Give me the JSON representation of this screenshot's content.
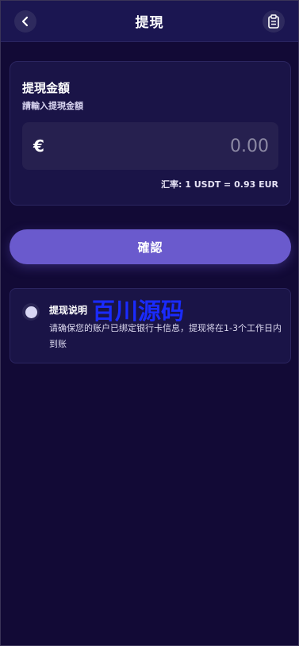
{
  "header": {
    "title": "提現",
    "back_icon": "chevron-left-icon",
    "record_icon": "clipboard-icon"
  },
  "amount": {
    "title": "提現金額",
    "subtitle": "請輸入提現金額",
    "currency_symbol": "€",
    "placeholder": "0.00",
    "value": "",
    "rate_text": "汇率: 1 USDT = 0.93 EUR"
  },
  "confirm_label": "確認",
  "info": {
    "title": "提现说明",
    "text": "请确保您的账户已绑定银行卡信息，提现将在1-3个工作日内到账"
  },
  "watermark": "百川源码",
  "colors": {
    "background": "#120a36",
    "header": "#1b1651",
    "card": "#1a1447",
    "accent": "#6a5acd",
    "watermark": "#1a2bff"
  }
}
